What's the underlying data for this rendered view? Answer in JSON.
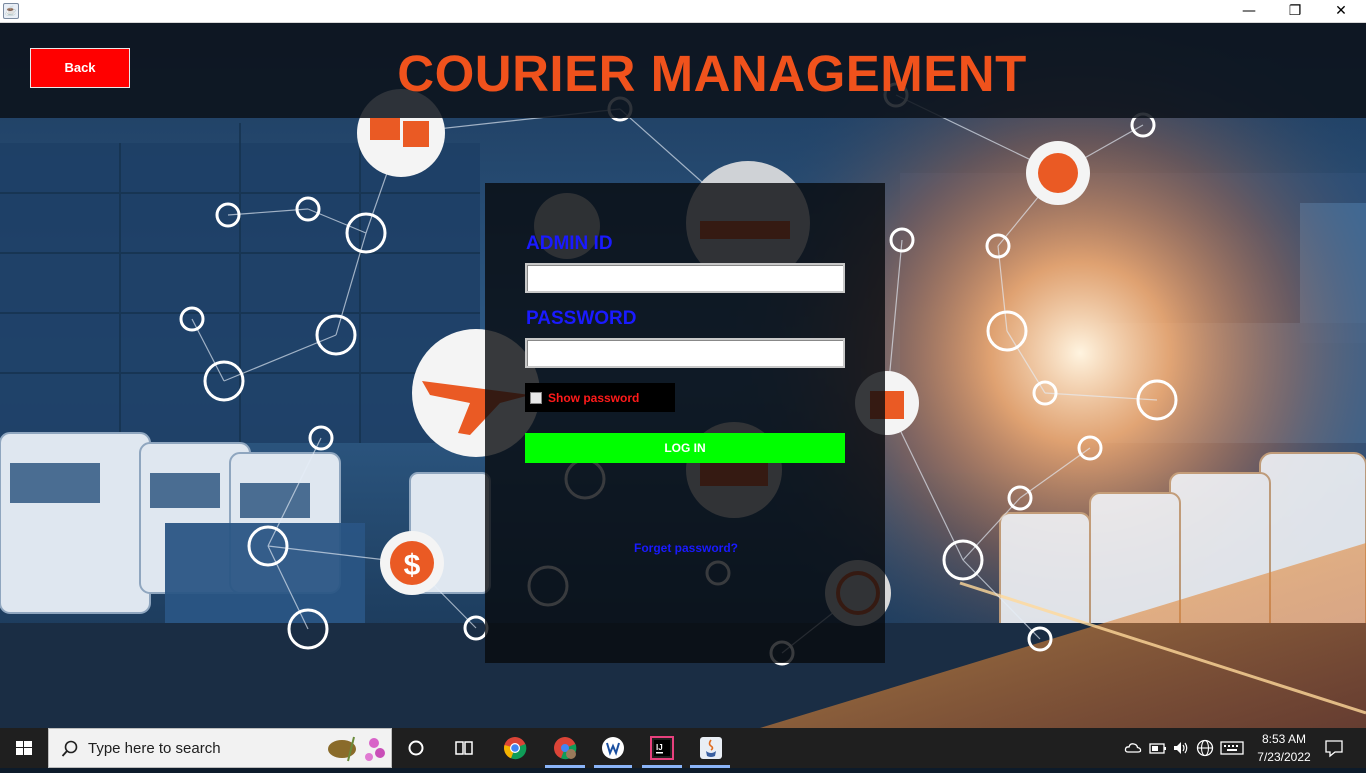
{
  "window": {
    "minimize_glyph": "—",
    "restore_glyph": "❐",
    "close_glyph": "✕",
    "icon": "java-app-icon"
  },
  "header": {
    "back_label": "Back",
    "title": "COURIER MANAGEMENT"
  },
  "login": {
    "admin_id_label": "ADMIN ID",
    "admin_id_value": "",
    "password_label": "PASSWORD",
    "password_value": "",
    "show_password_label": "Show password",
    "show_password_checked": false,
    "login_label": "LOG IN",
    "forgot_label": "Forget password?"
  },
  "taskbar": {
    "search_placeholder": "Type here to search",
    "time": "8:53 AM",
    "date": "7/23/2022",
    "pinned": [
      "task-view-icon",
      "chrome-icon",
      "chrome-profile-icon",
      "vscode-like-icon",
      "intellij-icon",
      "java-icon"
    ]
  },
  "colors": {
    "title": "#f0521c",
    "back_button": "#ff0000",
    "login_button": "#00ff00",
    "labels": "#1a1aff",
    "show_password_text": "#ff1a1a"
  }
}
